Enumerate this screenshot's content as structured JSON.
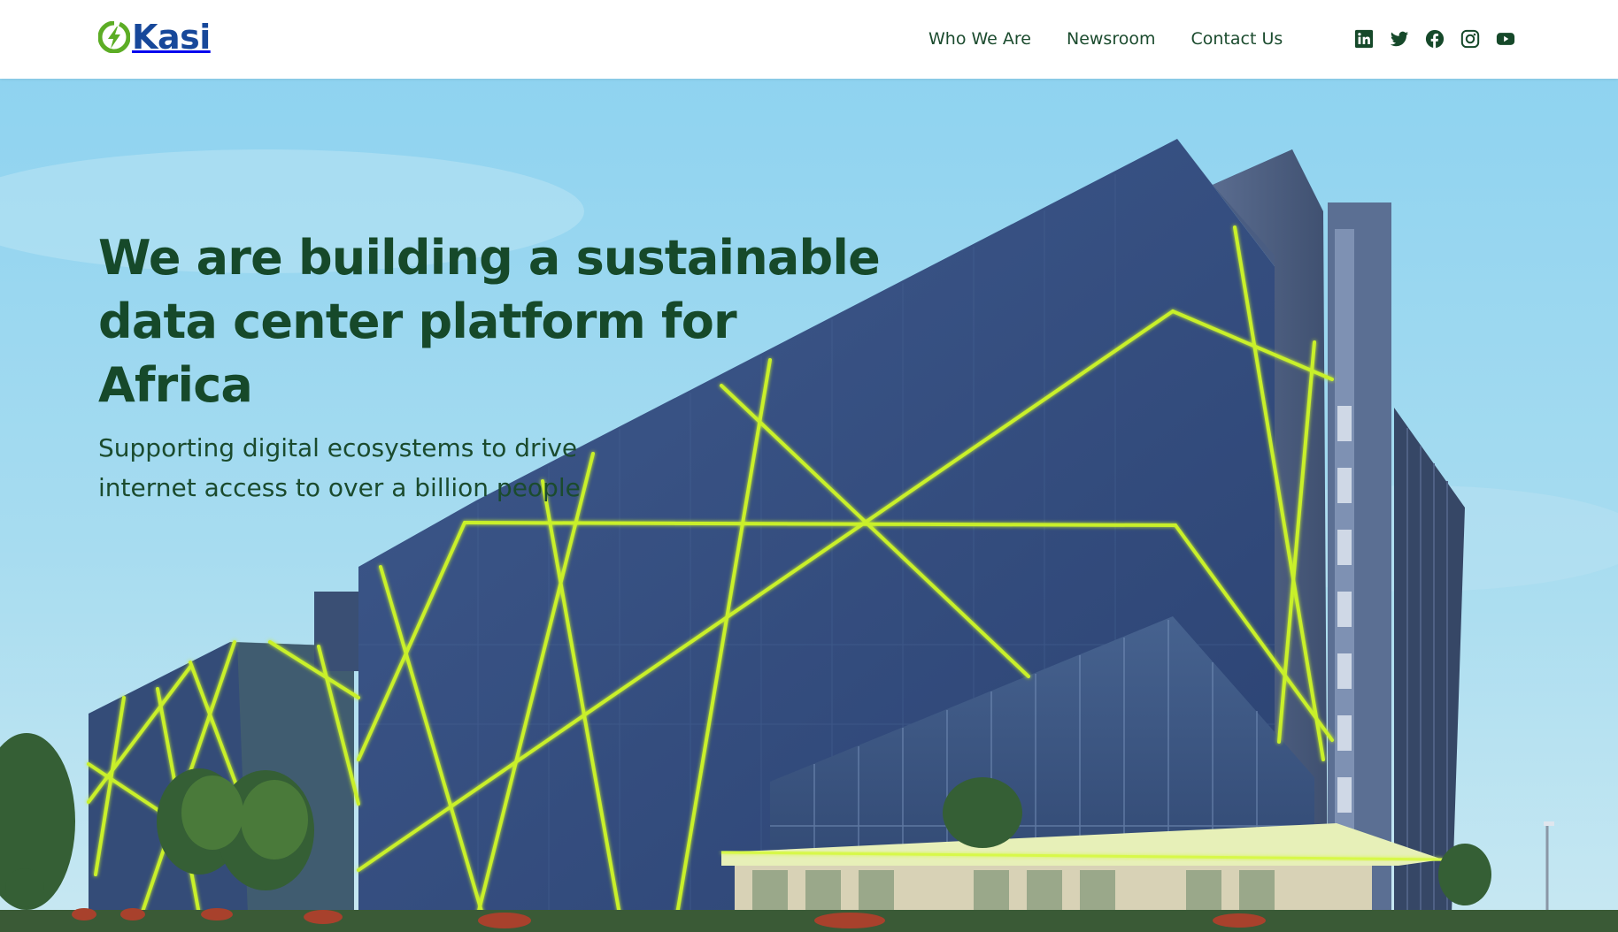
{
  "header": {
    "logo_text": "Kasi",
    "nav": [
      {
        "label": "Who We Are"
      },
      {
        "label": "Newsroom"
      },
      {
        "label": "Contact Us"
      }
    ],
    "social": [
      {
        "icon": "linkedin-icon"
      },
      {
        "icon": "twitter-icon"
      },
      {
        "icon": "facebook-icon"
      },
      {
        "icon": "instagram-icon"
      },
      {
        "icon": "youtube-icon"
      }
    ]
  },
  "hero": {
    "title_line1": "We are building a sustainable",
    "title_line2": "data center platform for Africa",
    "subtitle_line1": "Supporting digital ecosystems to drive",
    "subtitle_line2": "internet access to over a billion people",
    "image": "data-center-building-photo"
  },
  "colors": {
    "brand_blue": "#17489a",
    "brand_green": "#16492a",
    "accent_lime": "#c9f02a",
    "logo_green": "#5cad25"
  }
}
